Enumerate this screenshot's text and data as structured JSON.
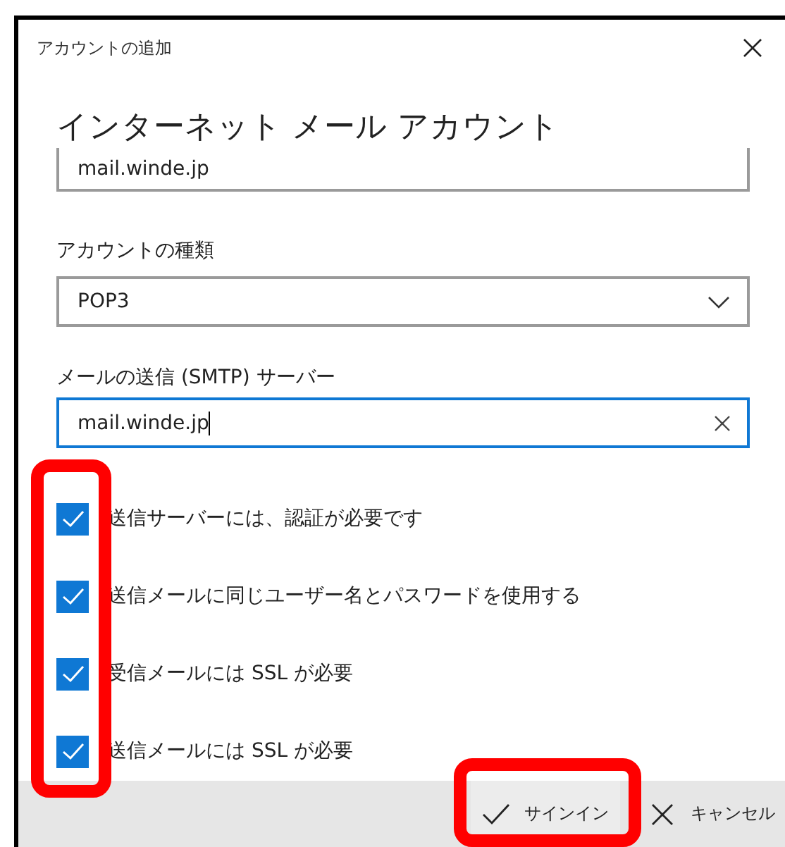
{
  "window": {
    "title": "アカウントの追加"
  },
  "heading": "インターネット メール アカウント",
  "partial_field": {
    "value": "mail.winde.jp"
  },
  "account_type": {
    "label": "アカウントの種類",
    "value": "POP3"
  },
  "smtp_server": {
    "label": "メールの送信 (SMTP) サーバー",
    "value": "mail.winde.jp"
  },
  "checkboxes": [
    {
      "label": "送信サーバーには、認証が必要です",
      "checked": true
    },
    {
      "label": "送信メールに同じユーザー名とパスワードを使用する",
      "checked": true
    },
    {
      "label": "受信メールには SSL が必要",
      "checked": true
    },
    {
      "label": "送信メールには SSL が必要",
      "checked": true
    }
  ],
  "buttons": [
    {
      "label": "サインイン",
      "kind": "confirm"
    },
    {
      "label": "キャンセル",
      "kind": "cancel"
    }
  ]
}
